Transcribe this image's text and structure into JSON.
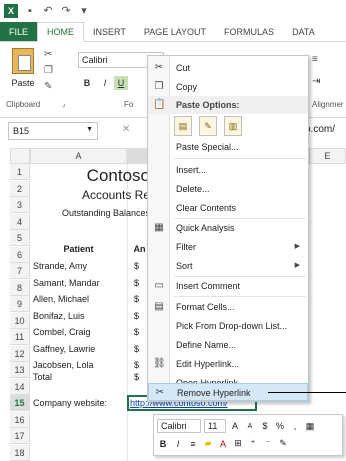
{
  "titlebar": {
    "logo": "X",
    "save_icon": "save-icon",
    "undo_icon": "undo-icon",
    "redo_icon": "redo-icon"
  },
  "tabs": [
    "FILE",
    "HOME",
    "INSERT",
    "PAGE LAYOUT",
    "FORMULAS",
    "DATA"
  ],
  "ribbon": {
    "paste_label": "Paste",
    "font_name": "Calibri",
    "bold": "B",
    "italic": "I",
    "underline": "U",
    "clipboard_group": "Clipboard",
    "font_group_abbrev": "Fo",
    "alignment_group_abbrev": "Alignmer"
  },
  "formula_bar": {
    "name_box": "B15",
    "cancel_symbol": "✕",
    "formula_tail": "o.com/"
  },
  "columns": [
    "A",
    "E"
  ],
  "rows": [
    "1",
    "2",
    "3",
    "4",
    "5",
    "6",
    "7",
    "8",
    "9",
    "10",
    "11",
    "12",
    "13",
    "14",
    "15",
    "16",
    "17",
    "18"
  ],
  "sheet": {
    "title": "Contoso",
    "subtitle": "Accounts Re",
    "balances": "Outstanding Balances",
    "col_patient": "Patient",
    "col_amount": "An",
    "patients": [
      "Strande, Amy",
      "Samant, Mandar",
      "Allen, Michael",
      "Bonifaz, Luis",
      "Combel, Craig",
      "Gaffney, Lawrie",
      "Jacobsen, Lola"
    ],
    "currency": "$",
    "total_label": "Total",
    "website_label": "Company website:",
    "website_link": "http://www.contoso.com/"
  },
  "context_menu": {
    "items": [
      {
        "label": "Cut",
        "icon": "cut-icon"
      },
      {
        "label": "Copy",
        "icon": "copy-icon"
      },
      {
        "label": "Paste Options:",
        "icon": "paste-icon"
      },
      {
        "label": "Paste Special...",
        "icon": ""
      },
      {
        "label": "Insert...",
        "icon": ""
      },
      {
        "label": "Delete...",
        "icon": ""
      },
      {
        "label": "Clear Contents",
        "icon": ""
      },
      {
        "label": "Quick Analysis",
        "icon": "quick-analysis-icon"
      },
      {
        "label": "Filter",
        "icon": ""
      },
      {
        "label": "Sort",
        "icon": ""
      },
      {
        "label": "Insert Comment",
        "icon": "comment-icon"
      },
      {
        "label": "Format Cells...",
        "icon": "format-cells-icon"
      },
      {
        "label": "Pick From Drop-down List...",
        "icon": ""
      },
      {
        "label": "Define Name...",
        "icon": ""
      },
      {
        "label": "Edit Hyperlink...",
        "icon": "hyperlink-icon"
      },
      {
        "label": "Open Hyperlink",
        "icon": ""
      },
      {
        "label": "Remove Hyperlink",
        "icon": "remove-hyperlink-icon"
      }
    ]
  },
  "mini_toolbar": {
    "font": "Calibri",
    "size": "11",
    "grow": "A",
    "shrink": "A",
    "currency": "$",
    "percent": "%",
    "comma": ",",
    "bold": "B",
    "italic": "I",
    "align": "≡"
  },
  "colors": {
    "excel_green": "#217346",
    "hover_blue": "#d5e8f7",
    "link_blue": "#0645ad"
  }
}
